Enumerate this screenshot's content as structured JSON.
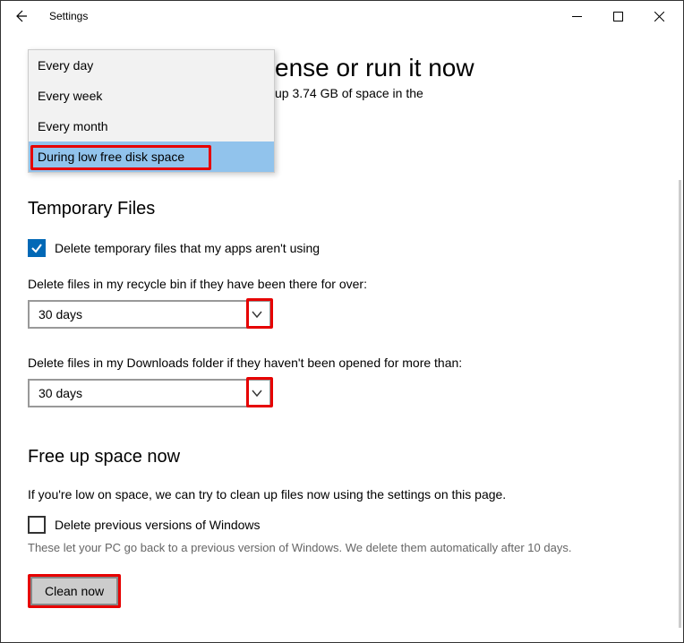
{
  "titlebar": {
    "title": "Settings"
  },
  "page": {
    "heading_fragment": "ense or run it now",
    "sub_fragment": "up 3.74 GB of space in the"
  },
  "menu": {
    "items": [
      "Every day",
      "Every week",
      "Every month",
      "During low free disk space"
    ],
    "selected_index": 3
  },
  "temp": {
    "heading": "Temporary Files",
    "chk_label": "Delete temporary files that my apps aren't using",
    "recycle_label": "Delete files in my recycle bin if they have been there for over:",
    "recycle_value": "30 days",
    "downloads_label": "Delete files in my Downloads folder if they haven't been opened for more than:",
    "downloads_value": "30 days"
  },
  "free": {
    "heading": "Free up space now",
    "para": "If you're low on space, we can try to clean up files now using the settings on this page.",
    "chk_label": "Delete previous versions of Windows",
    "hint": "These let your PC go back to a previous version of Windows. We delete them automatically after 10 days.",
    "button": "Clean now"
  }
}
